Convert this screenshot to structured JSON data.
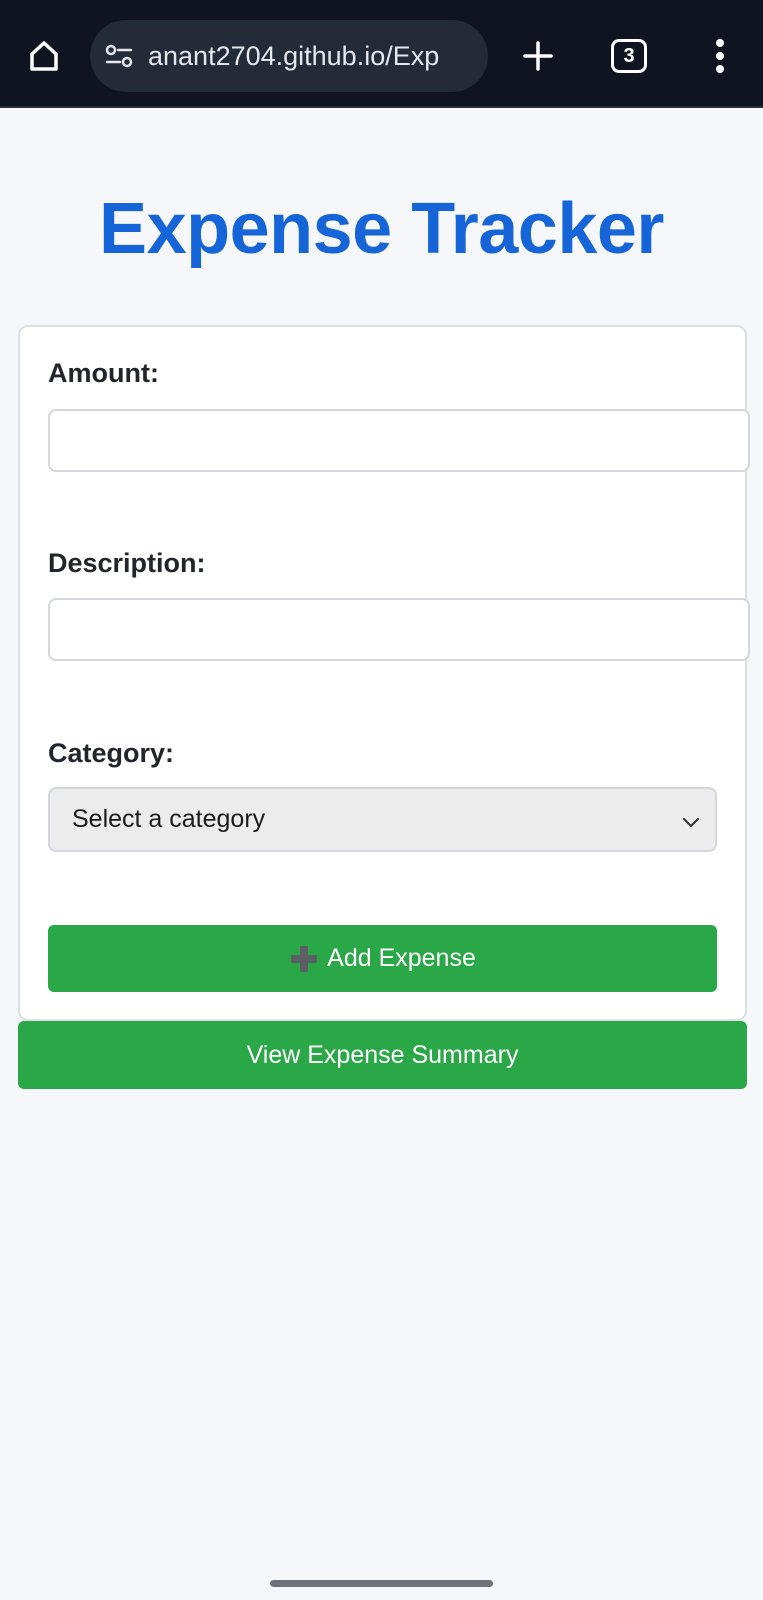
{
  "browser": {
    "url": "anant2704.github.io/Exp",
    "tab_count": "3",
    "icons": {
      "home": "home-icon",
      "site_info": "site-settings-icon",
      "new_tab": "plus-icon",
      "tabs": "tab-switcher-icon",
      "menu": "more-vert-icon"
    }
  },
  "page": {
    "title": "Expense Tracker",
    "form": {
      "amount_label": "Amount:",
      "amount_value": "",
      "description_label": "Description:",
      "description_value": "",
      "category_label": "Category:",
      "category_selected": "Select a category",
      "add_button_label": "Add Expense"
    },
    "summary_button_label": "View Expense Summary"
  },
  "colors": {
    "title": "#1565d8",
    "button": "#2aa746",
    "browser_bar": "#0f1420"
  }
}
